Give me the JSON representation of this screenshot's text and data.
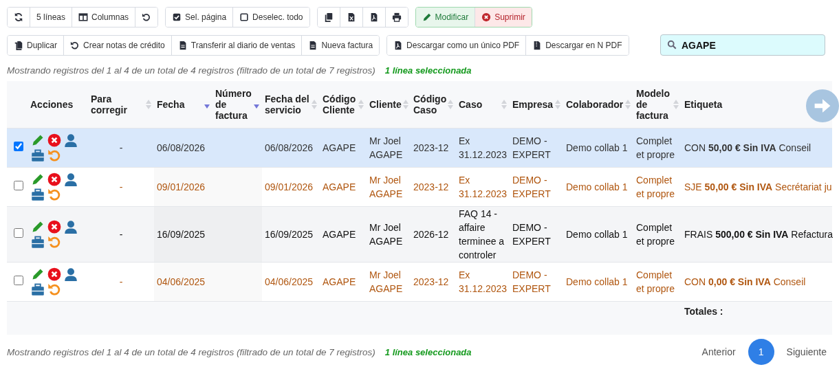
{
  "toolbar": {
    "groups": [
      {
        "buttons": [
          {
            "kind": "refresh"
          },
          {
            "label": "5 líneas",
            "kind": "plain"
          },
          {
            "label": "Columnas",
            "kind": "columns"
          },
          {
            "kind": "undo"
          }
        ]
      },
      {
        "buttons": [
          {
            "label": "Sel. página",
            "kind": "check"
          },
          {
            "label": "Deselec. todo",
            "kind": "uncheck"
          }
        ]
      },
      {
        "buttons": [
          {
            "kind": "copy"
          },
          {
            "kind": "excel"
          },
          {
            "kind": "pdf"
          },
          {
            "kind": "print"
          }
        ]
      },
      {
        "buttons": [
          {
            "label": "Modificar",
            "kind": "edit"
          },
          {
            "label": "Suprimir",
            "kind": "delete"
          }
        ]
      }
    ]
  },
  "actions": {
    "groups": [
      {
        "buttons": [
          {
            "label": "Duplicar",
            "kind": "duplicate"
          },
          {
            "label": "Crear notas de crédito",
            "kind": "undo"
          },
          {
            "label": "Transferir al diario de ventas",
            "kind": "file"
          },
          {
            "label": "Nueva factura",
            "kind": "file"
          }
        ]
      },
      {
        "buttons": [
          {
            "label": "Descargar como un único PDF",
            "kind": "pdf"
          },
          {
            "label": "Descargar en N PDF",
            "kind": "zip"
          }
        ]
      }
    ]
  },
  "search": {
    "value": "AGAPE"
  },
  "info_top": {
    "text": "Mostrando registros del 1 al 4 de un total de 4 registros (filtrado de un total de 7 registros)",
    "selection": "1 línea seleccionada"
  },
  "table": {
    "columns": [
      {
        "label": "Acciones"
      },
      {
        "label": "Para corregir",
        "sorted": false
      },
      {
        "label": "Fecha",
        "sorted": true
      },
      {
        "label": "Número de factura",
        "sorted": true
      },
      {
        "label": "Fecha del servicio",
        "sorted": false
      },
      {
        "label": "Código Cliente",
        "sorted": false
      },
      {
        "label": "Cliente",
        "sorted": false
      },
      {
        "label": "Código Caso",
        "sorted": false
      },
      {
        "label": "Caso",
        "sorted": false
      },
      {
        "label": "Empresa",
        "sorted": false
      },
      {
        "label": "Colaborador",
        "sorted": false
      },
      {
        "label": "Modelo de factura",
        "sorted": false
      },
      {
        "label": "Etiqueta"
      }
    ],
    "rows": [
      {
        "selected": true,
        "color": "#333333",
        "cells": [
          "",
          "-",
          "06/08/2026",
          "",
          "06/08/2026",
          "AGAPE",
          "Mr Joel AGAPE",
          "2023-12",
          "Ex 31.12.2023",
          "DEMO - EXPERT",
          "Demo collab 1",
          "Complet et propre",
          "CON **50,00 € Sin IVA** Conseil"
        ]
      },
      {
        "selected": false,
        "color": "#b0560f",
        "cells": [
          "",
          "-",
          "09/01/2026",
          "",
          "09/01/2026",
          "AGAPE",
          "Mr Joel AGAPE",
          "2023-12",
          "Ex 31.12.2023",
          "DEMO - EXPERT",
          "Demo collab 1",
          "Complet et propre",
          "SJE **50,00 € Sin IVA** Secrétariat ju"
        ]
      },
      {
        "selected": false,
        "color": "#111111",
        "cells": [
          "",
          "-",
          "16/09/2025",
          "",
          "16/09/2025",
          "AGAPE",
          "Mr Joel AGAPE",
          "2026-12",
          "FAQ 14 - affaire terminee a controler",
          "DEMO - EXPERT",
          "Demo collab 1",
          "Complet et propre",
          "FRAIS **500,00 € Sin IVA** Refactura"
        ]
      },
      {
        "selected": false,
        "color": "#b0560f",
        "cells": [
          "",
          "-",
          "04/06/2025",
          "",
          "04/06/2025",
          "AGAPE",
          "Mr Joel AGAPE",
          "2023-12",
          "Ex 31.12.2023",
          "DEMO - EXPERT",
          "Demo collab 1",
          "Complet et propre",
          "CON **0,00 € Sin IVA** Conseil"
        ]
      }
    ],
    "totals_label": "Totales :"
  },
  "info_bottom": {
    "text": "Mostrando registros del 1 al 4 de un total de 4 registros (filtrado de un total de 7 registros)",
    "selection": "1 línea seleccionada"
  },
  "pagination": {
    "previous": "Anterior",
    "pages": [
      {
        "label": "1",
        "selected": true
      }
    ],
    "next": "Siguiente"
  }
}
